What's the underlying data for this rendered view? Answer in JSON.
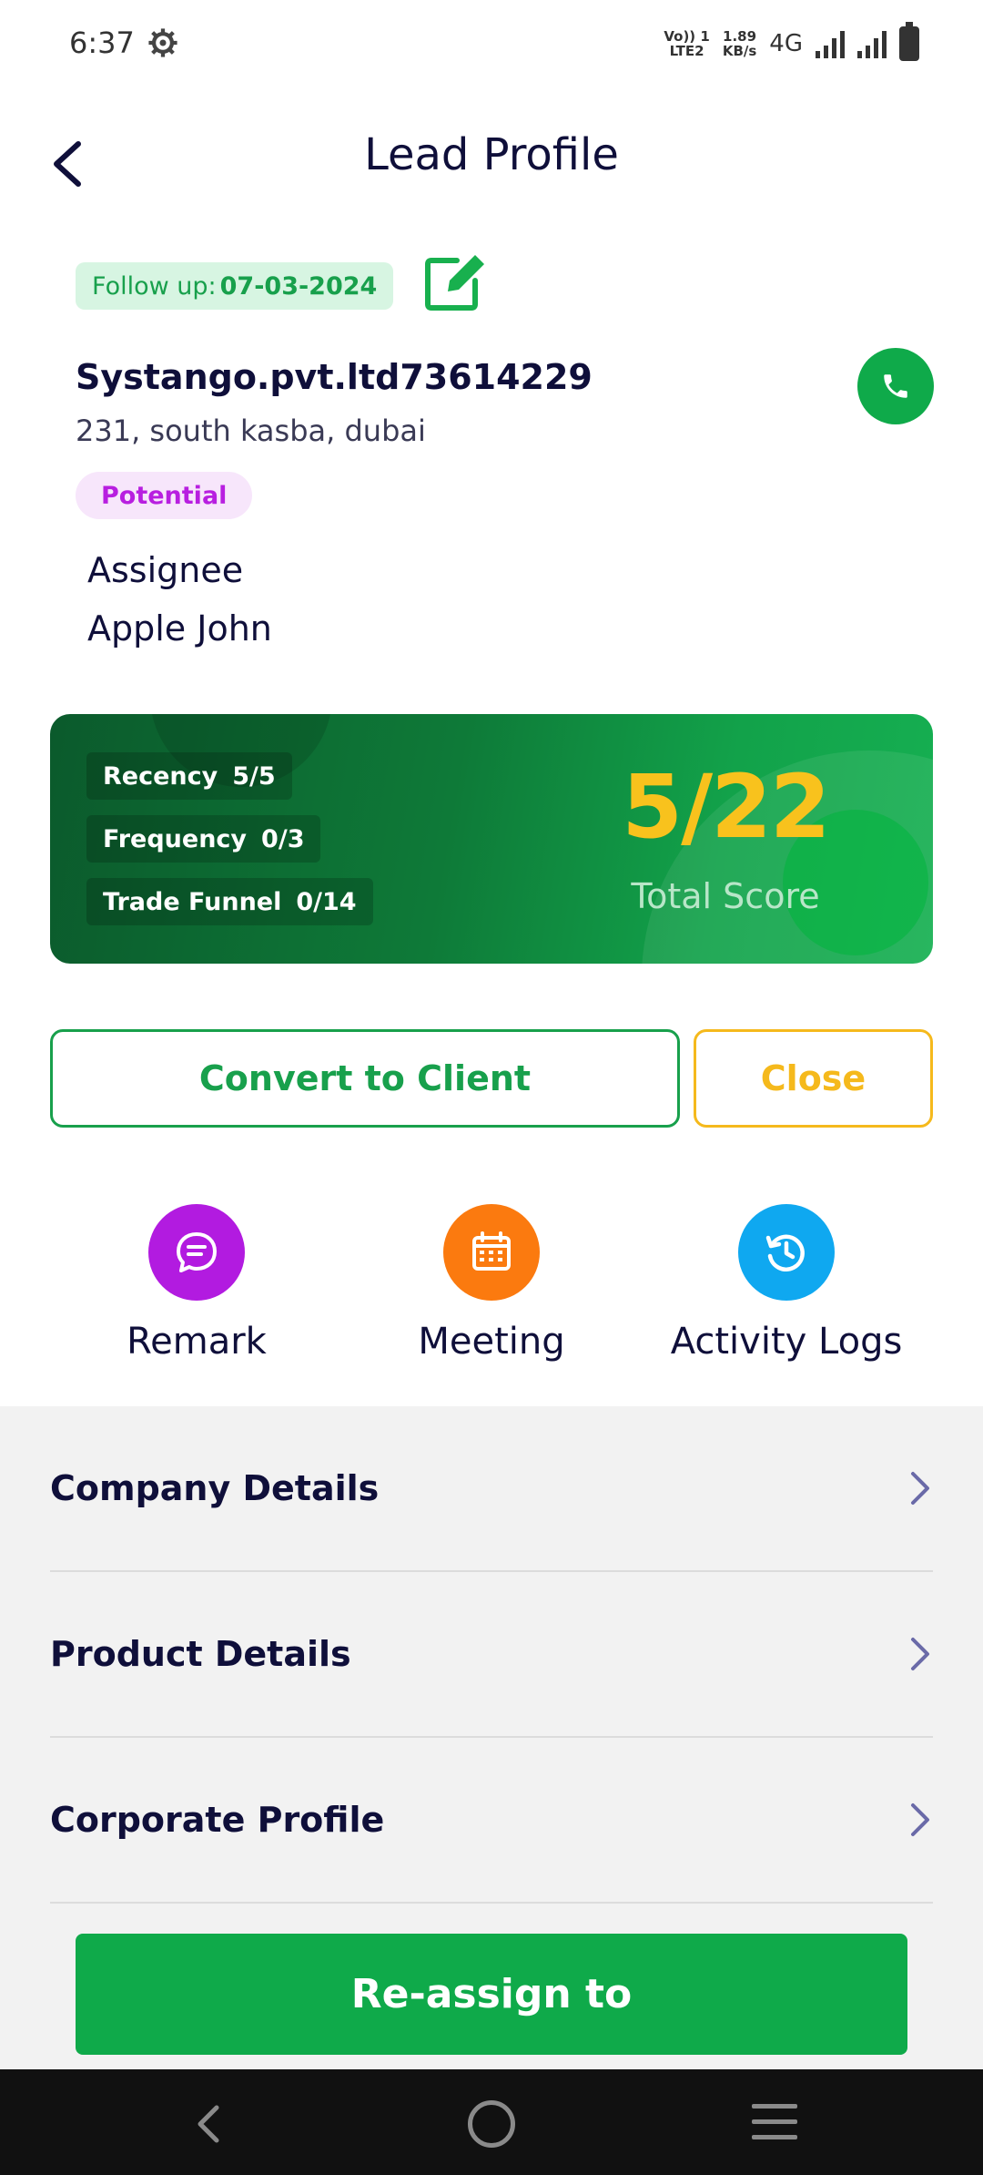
{
  "status_bar": {
    "time": "6:37",
    "network_line1": "Vo)) 1",
    "network_line2": "LTE2",
    "speed_value": "1.89",
    "speed_unit": "KB/s",
    "network_type": "4G"
  },
  "header": {
    "title": "Lead Profile",
    "back_icon": "chevron-left-icon"
  },
  "lead": {
    "follow_up_label": "Follow up:",
    "follow_up_date": "07-03-2024",
    "company_name": "Systango.pvt.ltd73614229",
    "address": "231, south kasba, dubai",
    "status_badge": "Potential",
    "assignee_label": "Assignee",
    "assignee_name": "Apple John"
  },
  "score_card": {
    "metrics": [
      {
        "label": "Recency",
        "value": "5/5"
      },
      {
        "label": "Frequency",
        "value": "0/3"
      },
      {
        "label": "Trade Funnel",
        "value": "0/14"
      }
    ],
    "total_value": "5/22",
    "total_label": "Total Score"
  },
  "actions": {
    "convert_label": "Convert to Client",
    "close_label": "Close"
  },
  "quick_actions": [
    {
      "label": "Remark",
      "icon": "chat-icon",
      "color": "#b21be0"
    },
    {
      "label": "Meeting",
      "icon": "calendar-icon",
      "color": "#fb7a0f"
    },
    {
      "label": "Activity Logs",
      "icon": "history-icon",
      "color": "#0fa8f0"
    }
  ],
  "details": [
    {
      "label": "Company Details"
    },
    {
      "label": "Product Details"
    },
    {
      "label": "Corporate Profile"
    }
  ],
  "footer": {
    "reassign_label": "Re-assign to"
  },
  "colors": {
    "primary_green": "#0faa4a",
    "accent_yellow": "#f5b91c",
    "potential_purple": "#b81fe0",
    "text_dark": "#0f0f3a"
  }
}
